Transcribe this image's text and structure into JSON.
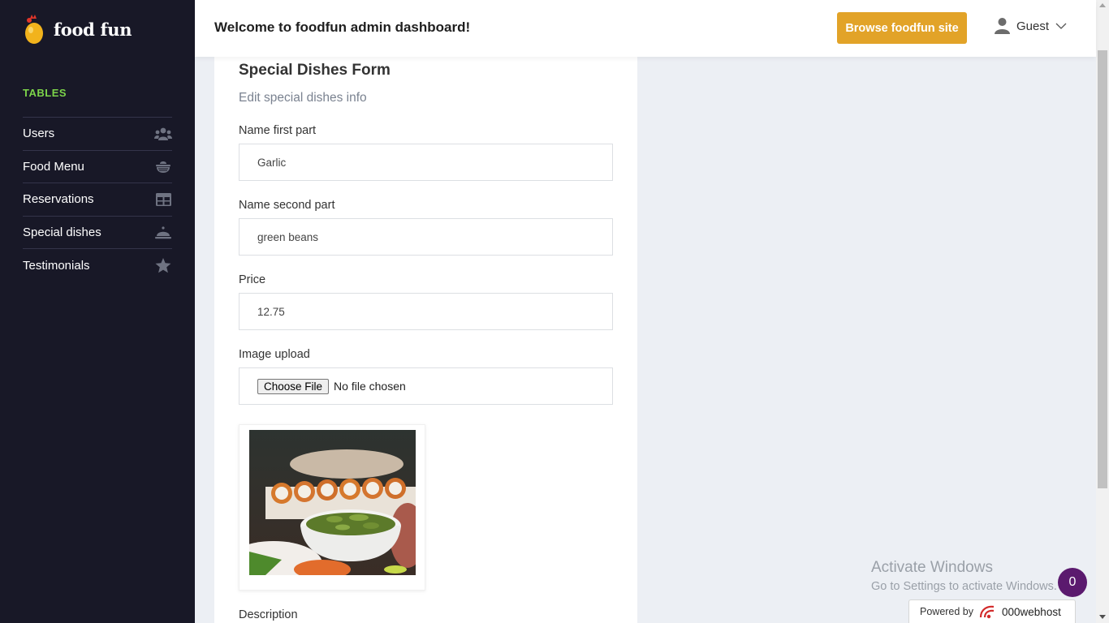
{
  "brand": {
    "name": "food fun"
  },
  "sidebar": {
    "section_title": "TABLES",
    "items": [
      {
        "label": "Users",
        "icon": "users-icon"
      },
      {
        "label": "Food Menu",
        "icon": "food-bowl-icon"
      },
      {
        "label": "Reservations",
        "icon": "table-icon"
      },
      {
        "label": "Special dishes",
        "icon": "cloche-icon"
      },
      {
        "label": "Testimonials",
        "icon": "star-icon"
      }
    ]
  },
  "header": {
    "title": "Welcome to foodfun admin dashboard!",
    "browse_label": "Browse foodfun site",
    "user_name": "Guest"
  },
  "form": {
    "title": "Special Dishes Form",
    "subtitle": "Edit special dishes info",
    "fields": {
      "name_first": {
        "label": "Name first part",
        "value": "Garlic"
      },
      "name_second": {
        "label": "Name second part",
        "value": "green beans"
      },
      "price": {
        "label": "Price",
        "value": "12.75"
      },
      "image": {
        "label": "Image upload",
        "button": "Choose File",
        "status": "No file chosen"
      },
      "description": {
        "label": "Description"
      }
    }
  },
  "overlay": {
    "activate_title": "Activate Windows",
    "activate_sub": "Go to Settings to activate Windows.",
    "badge_count": "0",
    "powered_by": "Powered by",
    "host_brand": "000webhost"
  },
  "colors": {
    "sidebar_bg": "#181827",
    "accent_green": "#7cd44a",
    "button_orange": "#e2a328",
    "page_bg": "#eceff4"
  }
}
